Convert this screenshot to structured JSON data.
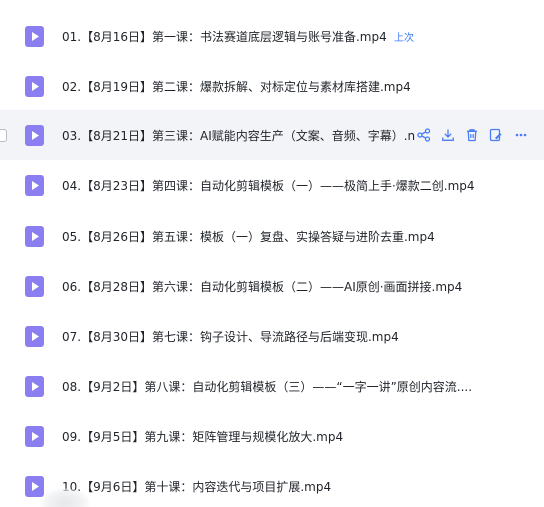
{
  "files": [
    {
      "name": "01.【8月16日】第一课：书法赛道底层逻辑与账号准备.mp4",
      "badge": "上次"
    },
    {
      "name": "02.【8月19日】第二课：爆款拆解、对标定位与素材库搭建.mp4"
    },
    {
      "name": "03.【8月21日】第三课：AI赋能内容生产（文案、音频、字幕）.n"
    },
    {
      "name": "04.【8月23日】第四课：自动化剪辑模板（一）——极简上手·爆款二创.mp4"
    },
    {
      "name": "05.【8月26日】第五课：模板（一）复盘、实操答疑与进阶去重.mp4"
    },
    {
      "name": "06.【8月28日】第六课：自动化剪辑模板（二）——AI原创·画面拼接.mp4"
    },
    {
      "name": "07.【8月30日】第七课：钩子设计、导流路径与后端变现.mp4"
    },
    {
      "name": "08.【9月2日】第八课：自动化剪辑模板（三）——“一字一讲”原创内容流...."
    },
    {
      "name": "09.【9月5日】第九课：矩阵管理与规模化放大.mp4"
    },
    {
      "name": "10.【9月6日】第十课：内容迭代与项目扩展.mp4"
    }
  ],
  "hover_actions": [
    "share-icon",
    "download-icon",
    "delete-icon",
    "rename-icon",
    "more-icon"
  ],
  "colors": {
    "file_icon": "#8b7ef0",
    "accent": "#3c7bf6",
    "hover_bg": "#f3f4f8",
    "text": "#1f2329"
  }
}
